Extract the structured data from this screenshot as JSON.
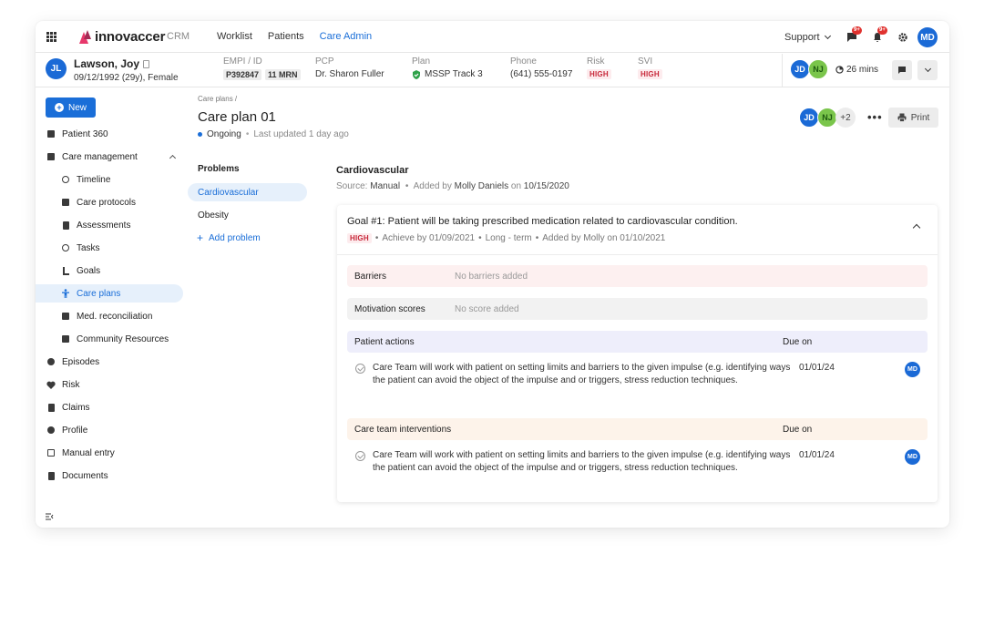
{
  "topnav": {
    "logo": "innovaccer",
    "product": "CRM",
    "links": [
      "Worklist",
      "Patients",
      "Care Admin"
    ],
    "active_link": "Care Admin",
    "support": "Support",
    "messages_badge": "9+",
    "notifications_badge": "9+",
    "user_initials": "MD"
  },
  "patient": {
    "initials": "JL",
    "name": "Lawson, Joy",
    "details": "09/12/1992 (29y), Female",
    "empi_label": "EMPI / ID",
    "empi_id": "P392847",
    "mrn": "11 MRN",
    "pcp_label": "PCP",
    "pcp": "Dr. Sharon Fuller",
    "plan_label": "Plan",
    "plan": "MSSP Track 3",
    "phone_label": "Phone",
    "phone": "(641) 555-0197",
    "risk_label": "Risk",
    "risk": "HIGH",
    "svi_label": "SVI",
    "svi": "HIGH",
    "care_team": [
      "JD",
      "NJ"
    ],
    "timer": "26 mins"
  },
  "sidebar": {
    "new_label": "New",
    "items": [
      {
        "label": "Patient 360",
        "icon": "id-card-icon"
      },
      {
        "label": "Care management",
        "icon": "chat-icon"
      },
      {
        "label": "Timeline",
        "icon": "clock-icon"
      },
      {
        "label": "Care protocols",
        "icon": "protocol-icon"
      },
      {
        "label": "Assessments",
        "icon": "clipboard-icon"
      },
      {
        "label": "Tasks",
        "icon": "alarm-icon"
      },
      {
        "label": "Goals",
        "icon": "flag-icon"
      },
      {
        "label": "Care plans",
        "icon": "person-icon"
      },
      {
        "label": "Med. reconciliation",
        "icon": "medication-icon"
      },
      {
        "label": "Community Resources",
        "icon": "building-icon"
      },
      {
        "label": "Episodes",
        "icon": "episodes-icon"
      },
      {
        "label": "Risk",
        "icon": "heart-icon"
      },
      {
        "label": "Claims",
        "icon": "claims-icon"
      },
      {
        "label": "Profile",
        "icon": "profile-icon"
      },
      {
        "label": "Manual entry",
        "icon": "edit-icon"
      },
      {
        "label": "Documents",
        "icon": "document-icon"
      }
    ]
  },
  "page": {
    "breadcrumb": "Care plans",
    "breadcrumb_sep": "/",
    "title": "Care plan 01",
    "status": "Ongoing",
    "updated": "Last updated 1 day ago",
    "team": [
      "JD",
      "NJ"
    ],
    "team_more": "+2",
    "print_label": "Print"
  },
  "problems": {
    "heading": "Problems",
    "items": [
      "Cardiovascular",
      "Obesity"
    ],
    "add_label": "Add problem"
  },
  "problem_detail": {
    "title": "Cardiovascular",
    "source_label": "Source:",
    "source": "Manual",
    "added_by_label": "Added by",
    "added_by": "Molly Daniels",
    "on_label": "on",
    "date": "10/15/2020"
  },
  "goal": {
    "title": "Goal #1: Patient will be taking prescribed medication related to cardiovascular condition.",
    "priority": "HIGH",
    "achieve_by": "Achieve by 01/09/2021",
    "term": "Long - term",
    "added": "Added by Molly on 01/10/2021",
    "barriers_label": "Barriers",
    "barriers_placeholder": "No barriers added",
    "motivation_label": "Motivation scores",
    "motivation_placeholder": "No score added",
    "actions_label": "Patient actions",
    "interventions_label": "Care team interventions",
    "due_label": "Due on",
    "action_text": "Care Team will work with patient on setting limits and barriers to the given impulse (e.g. identifying ways the patient can avoid the object of the impulse and or triggers, stress reduction techniques.",
    "action_due": "01/01/24",
    "action_assignee": "MD",
    "intervention_text": "Care Team will work with patient on setting limits and barriers to the given impulse (e.g. identifying ways the patient can avoid the object of the impulse and or triggers, stress reduction techniques.",
    "intervention_due": "01/01/24",
    "intervention_assignee": "MD"
  }
}
